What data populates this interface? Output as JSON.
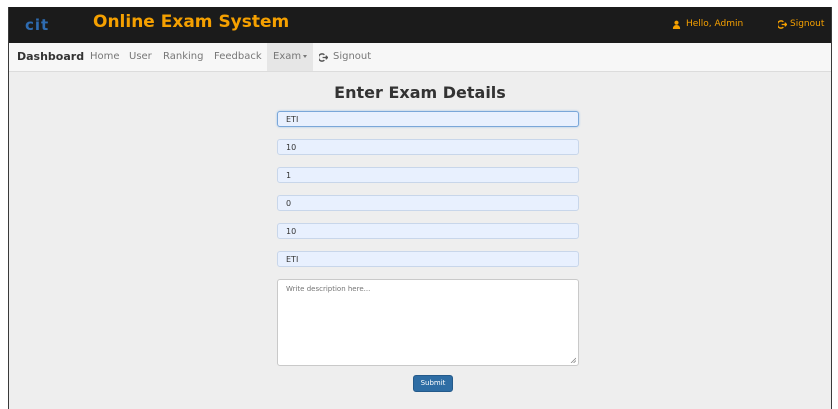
{
  "header": {
    "logo_text": "cit",
    "title": "Online Exam System",
    "greeting": "Hello, Admin",
    "signout": "Signout",
    "accent": "#f5a000"
  },
  "nav": {
    "brand": "Dashboard",
    "items": [
      "Home",
      "User",
      "Ranking",
      "Feedback"
    ],
    "exam": "Exam",
    "signout": "Signout"
  },
  "form": {
    "heading": "Enter Exam Details",
    "fields": [
      {
        "value": "ETI"
      },
      {
        "value": "10"
      },
      {
        "value": "1"
      },
      {
        "value": "0"
      },
      {
        "value": "10"
      },
      {
        "value": "ETI"
      }
    ],
    "description_placeholder": "Write description here...",
    "submit": "Submit"
  }
}
